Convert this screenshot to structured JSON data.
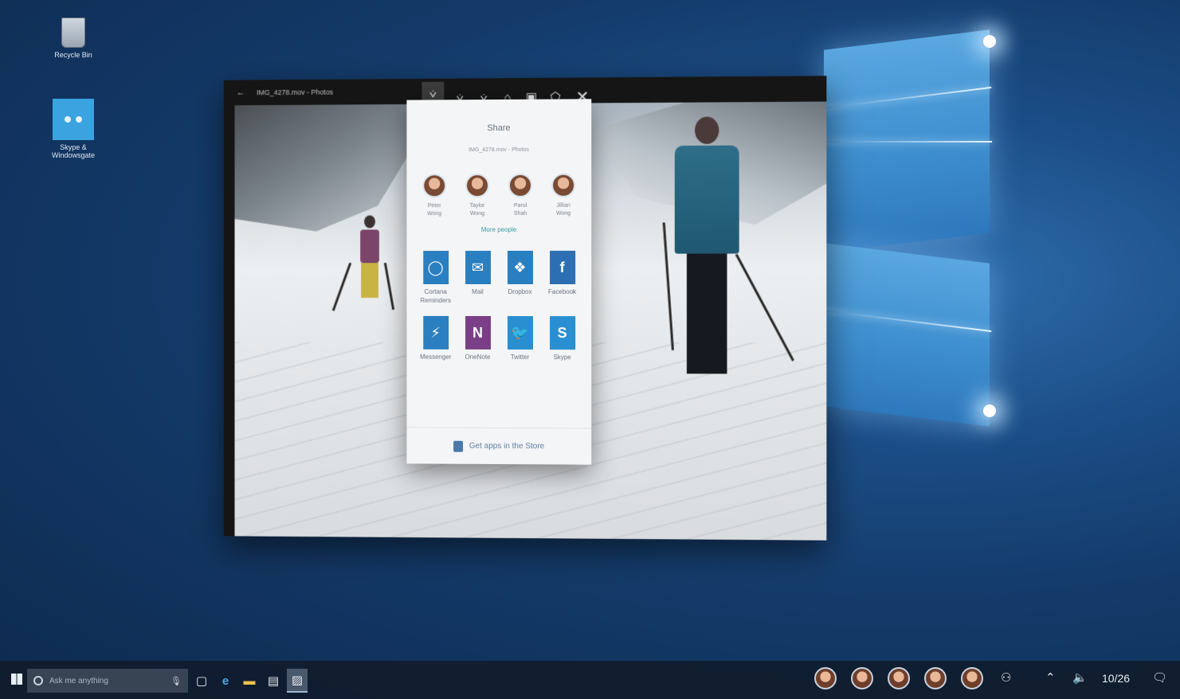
{
  "desktop": {
    "icons": [
      {
        "label": "Recycle Bin"
      },
      {
        "label": "Skype & Windowsgate"
      }
    ]
  },
  "photos_app": {
    "title": "IMG_4278.mov - Photos",
    "toolbar": {
      "close_glyph": "✕"
    }
  },
  "share": {
    "title": "Share",
    "subtitle": "IMG_4278.mov - Photos",
    "people": [
      {
        "line1": "Peter",
        "line2": "Wong"
      },
      {
        "line1": "Taylor",
        "line2": "Wong"
      },
      {
        "line1": "Parul",
        "line2": "Shah"
      },
      {
        "line1": "Jillian",
        "line2": "Wong"
      }
    ],
    "more_people": "More people",
    "apps": [
      {
        "label": "Cortana Reminders",
        "glyph": "◯",
        "color": "#2a7fc0"
      },
      {
        "label": "Mail",
        "glyph": "✉",
        "color": "#2a7fc0"
      },
      {
        "label": "Dropbox",
        "glyph": "❖",
        "color": "#2a7fc0"
      },
      {
        "label": "Facebook",
        "glyph": "f",
        "color": "#2d6fb3"
      },
      {
        "label": "Messenger",
        "glyph": "⚡",
        "color": "#2a7fc0"
      },
      {
        "label": "OneNote",
        "glyph": "N",
        "color": "#7a3f86"
      },
      {
        "label": "Twitter",
        "glyph": "🐦",
        "color": "#2a8fd0"
      },
      {
        "label": "Skype",
        "glyph": "S",
        "color": "#2a8fd0"
      }
    ],
    "store_link": "Get apps in the Store"
  },
  "taskbar": {
    "search_placeholder": "Ask me anything",
    "clock": "10/26"
  },
  "colors": {
    "accent": "#2a7fc0",
    "link": "#3a9aa0",
    "taskbar": "#101c2c"
  }
}
